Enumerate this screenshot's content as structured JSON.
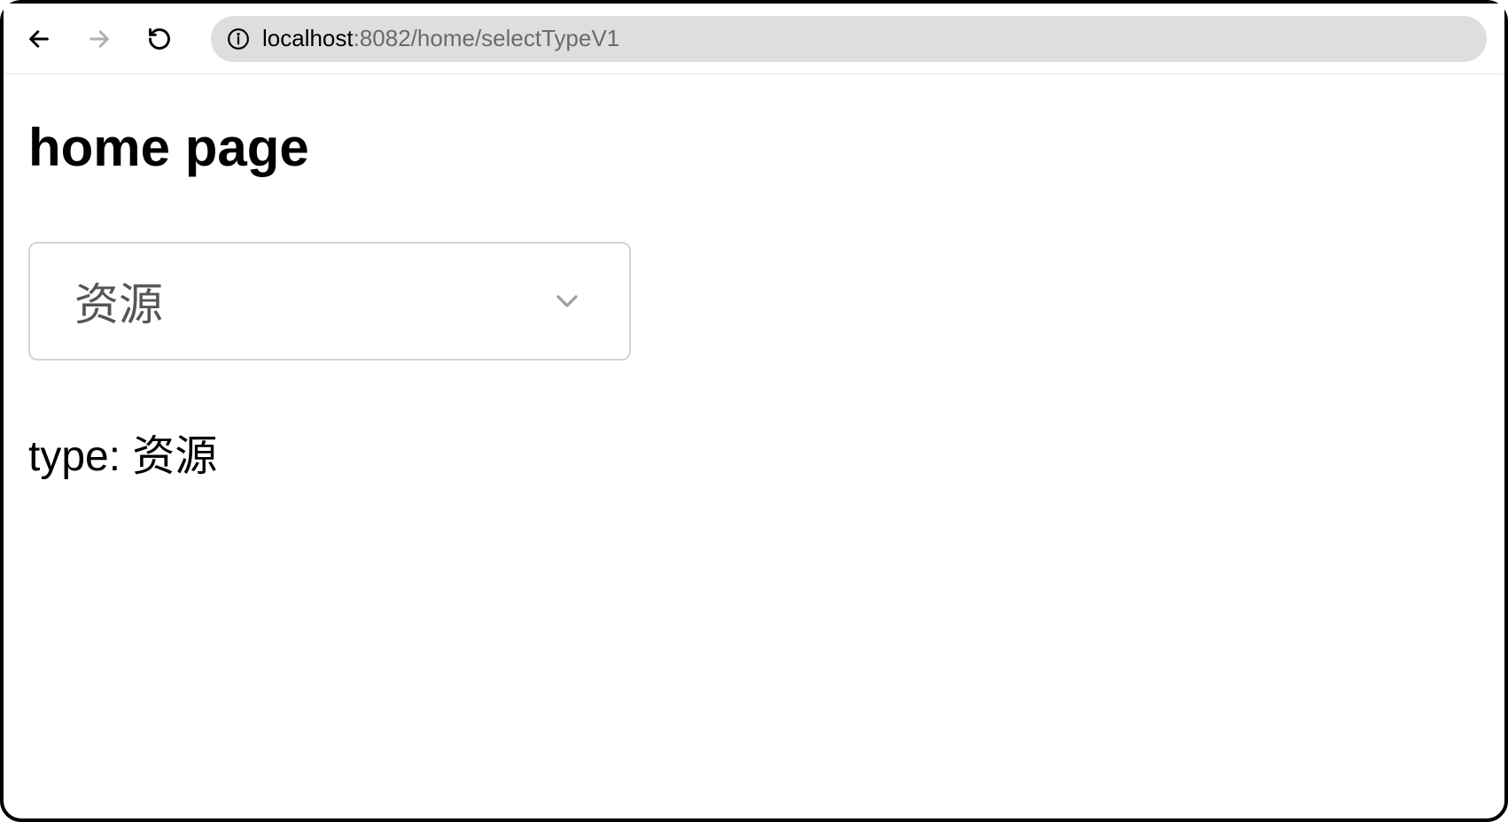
{
  "browser": {
    "url_host": "localhost",
    "url_path": ":8082/home/selectTypeV1"
  },
  "page": {
    "title": "home page",
    "select": {
      "selected_value": "资源"
    },
    "type_label": "type: ",
    "type_value": "资源"
  }
}
